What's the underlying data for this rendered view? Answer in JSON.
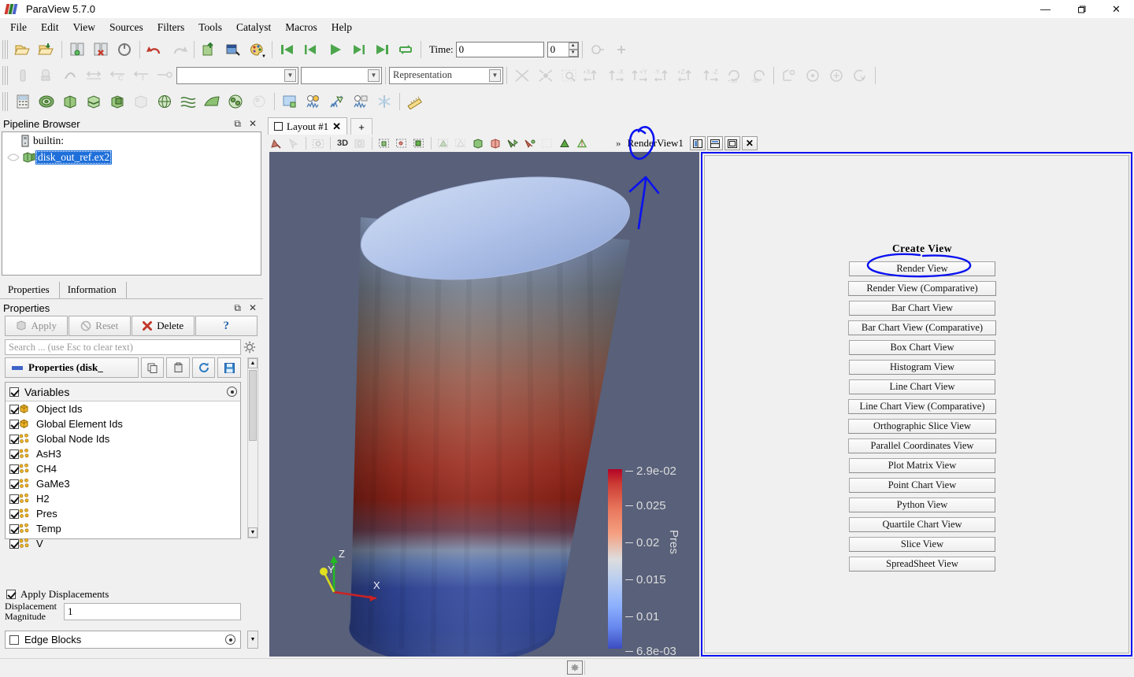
{
  "window": {
    "title": "ParaView 5.7.0",
    "minimize": "—",
    "restore": "❐",
    "close": "✕"
  },
  "menu": {
    "items": [
      "File",
      "Edit",
      "View",
      "Sources",
      "Filters",
      "Tools",
      "Catalyst",
      "Macros",
      "Help"
    ]
  },
  "toolbar": {
    "time_label": "Time:",
    "time_value": "0",
    "time_index": "0",
    "representation_placeholder": "Representation",
    "array_placeholder": "",
    "component_placeholder": "",
    "camera_buttons": [
      "+X",
      "-X",
      "+Y",
      "-Y",
      "+Z",
      "-Z",
      "+90",
      "-90"
    ],
    "view3d_label": "3D"
  },
  "pipeline": {
    "title": "Pipeline Browser",
    "items": [
      {
        "label": "builtin:",
        "selected": false,
        "type": "server"
      },
      {
        "label": "disk_out_ref.ex2",
        "selected": true,
        "type": "source"
      }
    ]
  },
  "dock_tabs": {
    "tabs": [
      "Properties",
      "Information"
    ],
    "active": "Properties"
  },
  "properties": {
    "title": "Properties",
    "buttons": [
      {
        "label": "Apply",
        "enabled": false,
        "icon": "apply-icon"
      },
      {
        "label": "Reset",
        "enabled": false,
        "icon": "reset-icon"
      },
      {
        "label": "Delete",
        "enabled": true,
        "icon": "delete-icon"
      },
      {
        "label": "?",
        "enabled": true,
        "icon": "help-icon"
      }
    ],
    "search_placeholder": "Search ... (use Esc to clear text)",
    "section_header": "Properties (disk_",
    "variables_header": "Variables",
    "variables": [
      {
        "label": "Object Ids",
        "checked": true,
        "icon": "cell-data-icon"
      },
      {
        "label": "Global Element Ids",
        "checked": true,
        "icon": "cell-data-icon"
      },
      {
        "label": "Global Node Ids",
        "checked": true,
        "icon": "point-data-icon"
      },
      {
        "label": "AsH3",
        "checked": true,
        "icon": "point-data-icon"
      },
      {
        "label": "CH4",
        "checked": true,
        "icon": "point-data-icon"
      },
      {
        "label": "GaMe3",
        "checked": true,
        "icon": "point-data-icon"
      },
      {
        "label": "H2",
        "checked": true,
        "icon": "point-data-icon"
      },
      {
        "label": "Pres",
        "checked": true,
        "icon": "point-data-icon"
      },
      {
        "label": "Temp",
        "checked": true,
        "icon": "point-data-icon"
      },
      {
        "label": "V",
        "checked": true,
        "icon": "point-data-icon"
      }
    ],
    "apply_displacements": {
      "label": "Apply Displacements",
      "checked": true
    },
    "displacement_magnitude": {
      "label_line1": "Displacement",
      "label_line2": "Magnitude",
      "value": "1"
    },
    "edge_blocks": {
      "label": "Edge Blocks",
      "checked": false
    }
  },
  "layout": {
    "tab_label": "Layout #1",
    "tab_close": "✕",
    "add_tab": "+",
    "overflow": "»",
    "view_name": "RenderView1",
    "view_buttons": [
      "split-horizontal",
      "split-vertical",
      "maximize",
      "close"
    ]
  },
  "render_view": {
    "background": "#58607a",
    "orientation_axes": {
      "x": "X",
      "y": "Y",
      "z": "Z"
    },
    "scalar_bar": {
      "title": "Pres",
      "ticks": [
        "2.9e-02",
        "0.025",
        "0.02",
        "0.015",
        "0.01",
        "6.8e-03"
      ],
      "color_top": "#3b4cc0",
      "color_bottom": "#b40426",
      "range_min": "6.8e-03",
      "range_max": "2.9e-02"
    }
  },
  "create_view": {
    "title": "Create View",
    "buttons": [
      "Render View",
      "Render View (Comparative)",
      "Bar Chart View",
      "Bar Chart View (Comparative)",
      "Box Chart View",
      "Histogram View",
      "Line Chart View",
      "Line Chart View (Comparative)",
      "Orthographic Slice View",
      "Parallel Coordinates View",
      "Plot Matrix View",
      "Point Chart View",
      "Python View",
      "Quartile Chart View",
      "Slice View",
      "SpreadSheet View"
    ],
    "highlighted": "Render View"
  },
  "annotation": {
    "color": "#0a12f0",
    "marks": [
      "circle-around-split-horizontal-button",
      "arrow-pointing-up",
      "circle-around-render-view-button"
    ]
  },
  "statusbar": {
    "text": ""
  }
}
